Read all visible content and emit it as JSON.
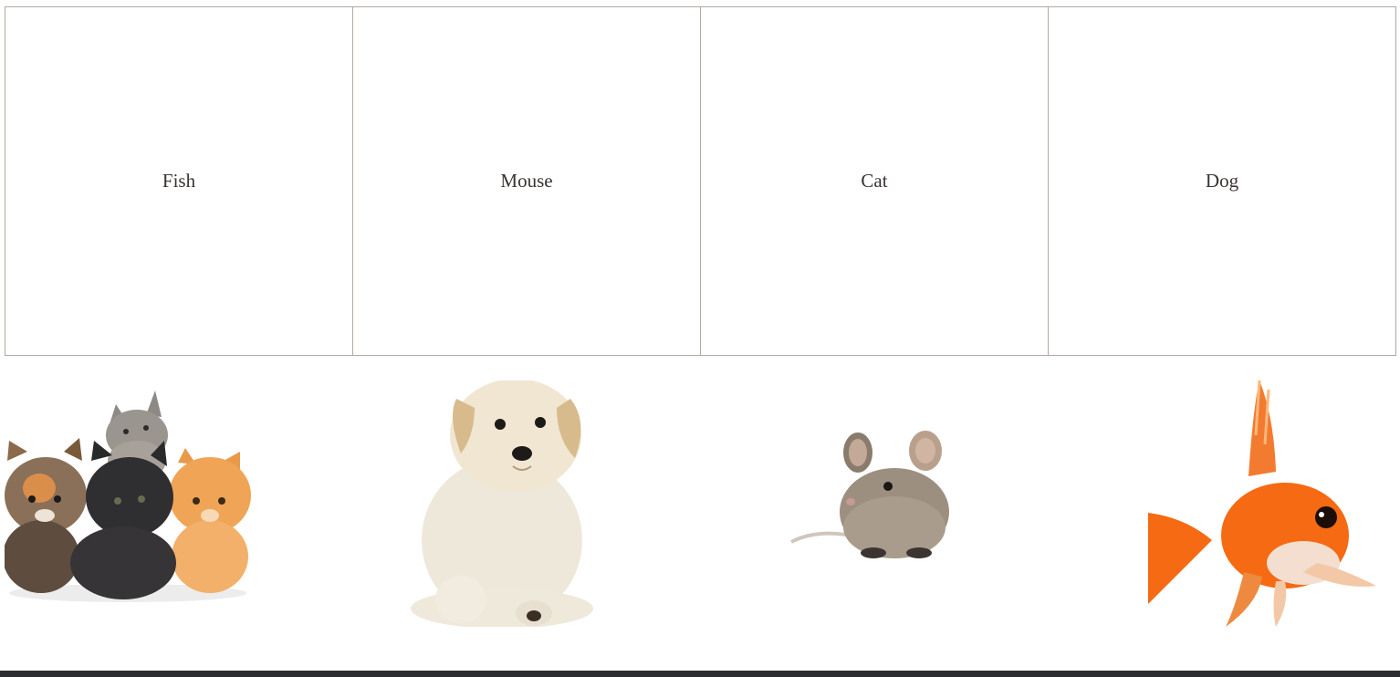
{
  "drop_zones": [
    {
      "label": "Fish"
    },
    {
      "label": "Mouse"
    },
    {
      "label": "Cat"
    },
    {
      "label": "Dog"
    }
  ],
  "draggable_images": [
    {
      "icon": "kittens-image"
    },
    {
      "icon": "puppy-image"
    },
    {
      "icon": "mouse-image"
    },
    {
      "icon": "goldfish-image"
    }
  ]
}
